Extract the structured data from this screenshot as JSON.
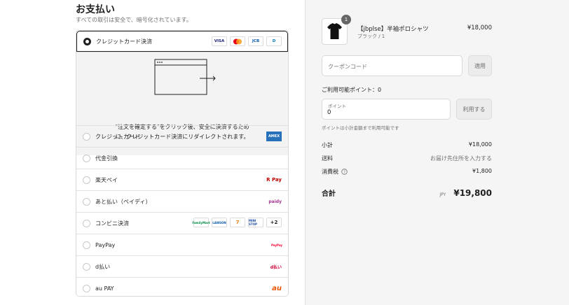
{
  "payment": {
    "title": "お支払い",
    "subtitle": "すべての取引は安全で、暗号化されています。",
    "selected_method": "クレジットカード決済",
    "redirect_text_line1": "\"注文を確定する\"をクリック後、安全に決済するため",
    "redirect_text_line2": "に、クレジットカード決済にリダイレクトされます。",
    "card_brands": [
      "VISA",
      "MC",
      "JCB",
      "D"
    ],
    "methods": [
      {
        "label": "クレジットカード",
        "logo": "AMEX"
      },
      {
        "label": "代金引換",
        "logo": ""
      },
      {
        "label": "楽天ペイ",
        "logo": "R Pay"
      },
      {
        "label": "あと払い（ペイディ）",
        "logo": "paidy"
      },
      {
        "label": "コンビニ決済",
        "logo": ""
      },
      {
        "label": "PayPay",
        "logo": "PayPay"
      },
      {
        "label": "d払い",
        "logo": "d払い"
      },
      {
        "label": "au PAY",
        "logo": "au"
      }
    ],
    "stores": [
      "FamilyMart",
      "LAWSON",
      "7",
      "MINI STOP"
    ],
    "stores_more": "+2"
  },
  "cart": {
    "badge_count": "1",
    "product_name": "【jbplse】半袖ポロシャツ",
    "product_variant": "ブラック / 1",
    "product_price": "¥18,000"
  },
  "coupon": {
    "placeholder": "クーポンコード",
    "apply_label": "適用"
  },
  "points": {
    "title": "ご利用可能ポイント：0",
    "field_label": "ポイント",
    "field_value": "0",
    "use_label": "利用する",
    "note": "ポイントは小計金額まで利用可能です"
  },
  "summary": {
    "subtotal_label": "小計",
    "subtotal_value": "¥18,000",
    "shipping_label": "送料",
    "shipping_value": "お届け先住所を入力する",
    "tax_label": "消費税",
    "tax_value": "¥1,800",
    "total_label": "合計",
    "total_currency": "JPY",
    "total_value": "¥19,800"
  }
}
